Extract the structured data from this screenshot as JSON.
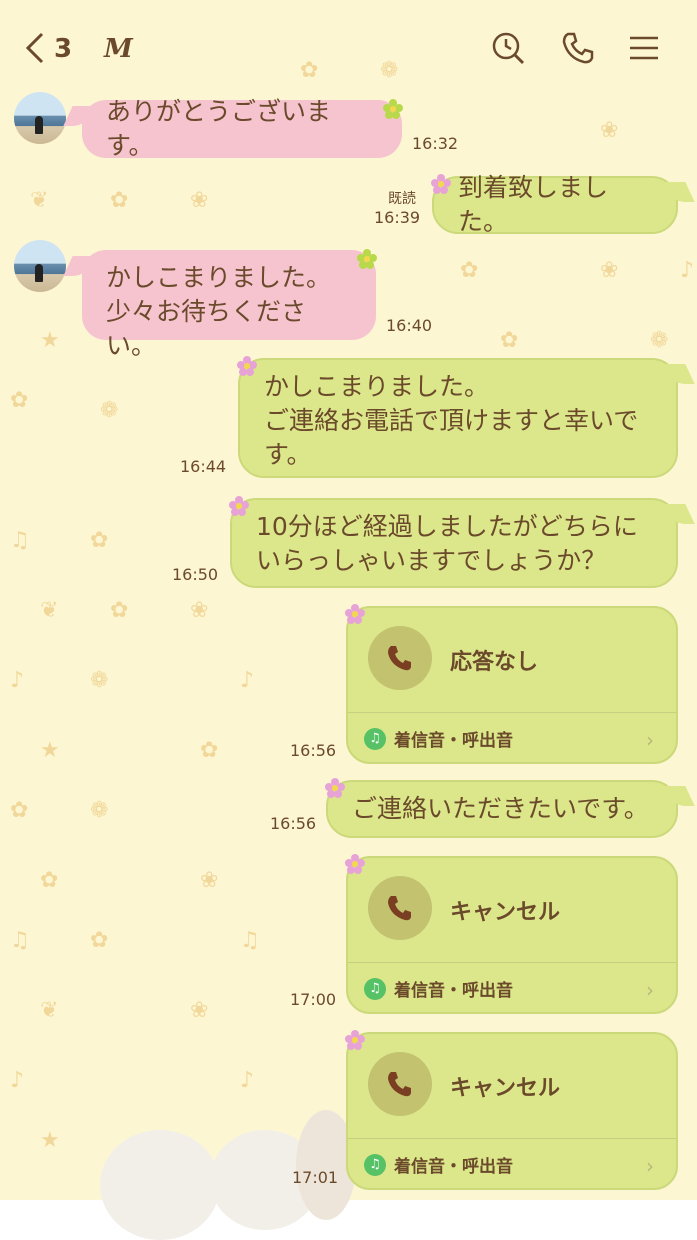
{
  "header": {
    "back_icon": "chevron-left-icon",
    "unread_count": "3",
    "contact_name": "M",
    "icons": [
      "search-history-icon",
      "phone-icon",
      "menu-icon"
    ]
  },
  "messages": [
    {
      "side": "left",
      "text_lines": [
        "ありがとうございます。"
      ],
      "time": "16:32"
    },
    {
      "side": "right",
      "text_lines": [
        "到着致しました。"
      ],
      "time": "16:39",
      "read": "既読"
    },
    {
      "side": "left",
      "text_lines": [
        "かしこまりました。",
        "少々お待ちください。"
      ],
      "time": "16:40"
    },
    {
      "side": "right",
      "text_lines": [
        "かしこまりました。",
        "ご連絡お電話で頂けますと幸いで",
        "す。"
      ],
      "time": "16:44"
    },
    {
      "side": "right",
      "text_lines": [
        "10分ほど経過しましたがどちらに",
        "いらっしゃいますでしょうか？"
      ],
      "time": "16:50"
    },
    {
      "side": "right",
      "type": "call",
      "label": "応答なし",
      "note": "着信音・呼出音",
      "time": "16:56"
    },
    {
      "side": "right",
      "text_lines": [
        "ご連絡いただきたいです。"
      ],
      "time": "16:56"
    },
    {
      "side": "right",
      "type": "call",
      "label": "キャンセル",
      "note": "着信音・呼出音",
      "time": "17:00"
    },
    {
      "side": "right",
      "type": "call",
      "label": "キャンセル",
      "note": "着信音・呼出音",
      "time": "17:01"
    }
  ],
  "colors": {
    "background": "#fdf6d3",
    "pink_bubble": "#f6c4cf",
    "green_bubble": "#dce78b",
    "text": "#6b4a2b"
  }
}
